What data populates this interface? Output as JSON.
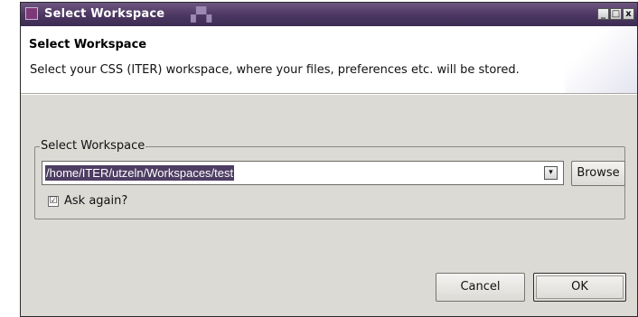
{
  "window": {
    "title": "Select Workspace",
    "controls": {
      "minimize": "_",
      "maximize": "□",
      "close": "x"
    }
  },
  "header": {
    "title": "Select Workspace",
    "description": "Select your CSS (ITER) workspace, where your files, preferences etc. will be stored."
  },
  "workspace_group": {
    "legend": "Select Workspace",
    "path_value": "/home/ITER/utzeln/Workspaces/test",
    "browse_label": "Browse",
    "ask_again": {
      "label": "Ask again?",
      "checked": true,
      "mark": "☑"
    }
  },
  "buttons": {
    "cancel": "Cancel",
    "ok": "OK"
  },
  "icons": {
    "dropdown": "▾"
  }
}
